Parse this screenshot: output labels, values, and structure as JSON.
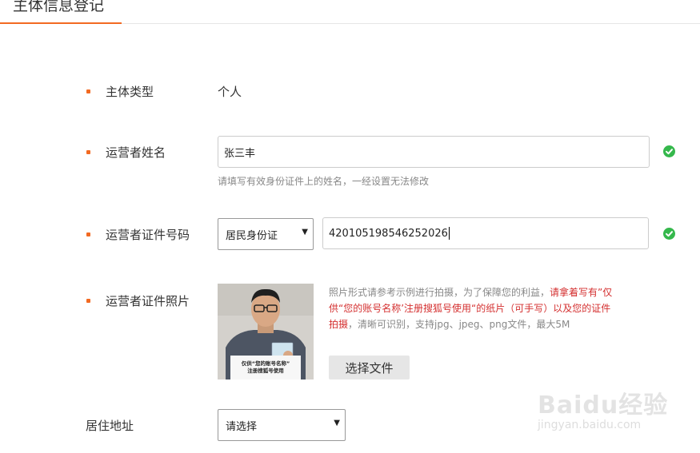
{
  "header": {
    "title": "主体信息登记"
  },
  "form": {
    "subject_type": {
      "label": "主体类型",
      "value": "个人"
    },
    "operator_name": {
      "label": "运营者姓名",
      "value": "张三丰",
      "hint": "请填写有效身份证件上的姓名，一经设置无法修改",
      "status_icon": "check-circle-icon"
    },
    "operator_id": {
      "label": "运营者证件号码",
      "id_type": "居民身份证",
      "value": "420105198546252026",
      "status_icon": "check-circle-icon"
    },
    "operator_photo": {
      "label": "运营者证件照片",
      "sample_sign_line1": "仅供“您的账号名称”",
      "sample_sign_line2": "注册搜狐号使用",
      "desc_part1": "照片形式请参考示例进行拍摄，为了保障您的利益，",
      "desc_red": "请拿着写有”仅供“您的账号名称’注册搜狐号使用“的纸片（可手写）以及您的证件拍摄",
      "desc_part2": "，清晰可识别，支持jpg、jpeg、png文件，最大5M",
      "button_label": "选择文件"
    },
    "address": {
      "label": "居住地址",
      "placeholder": "请选择"
    }
  },
  "watermark": {
    "logo_text": "Baidu经验",
    "url_text": "jingyan.baidu.com"
  },
  "colors": {
    "accent": "#f26a22",
    "success": "#35b84c",
    "warning_text": "#d42f2f"
  }
}
